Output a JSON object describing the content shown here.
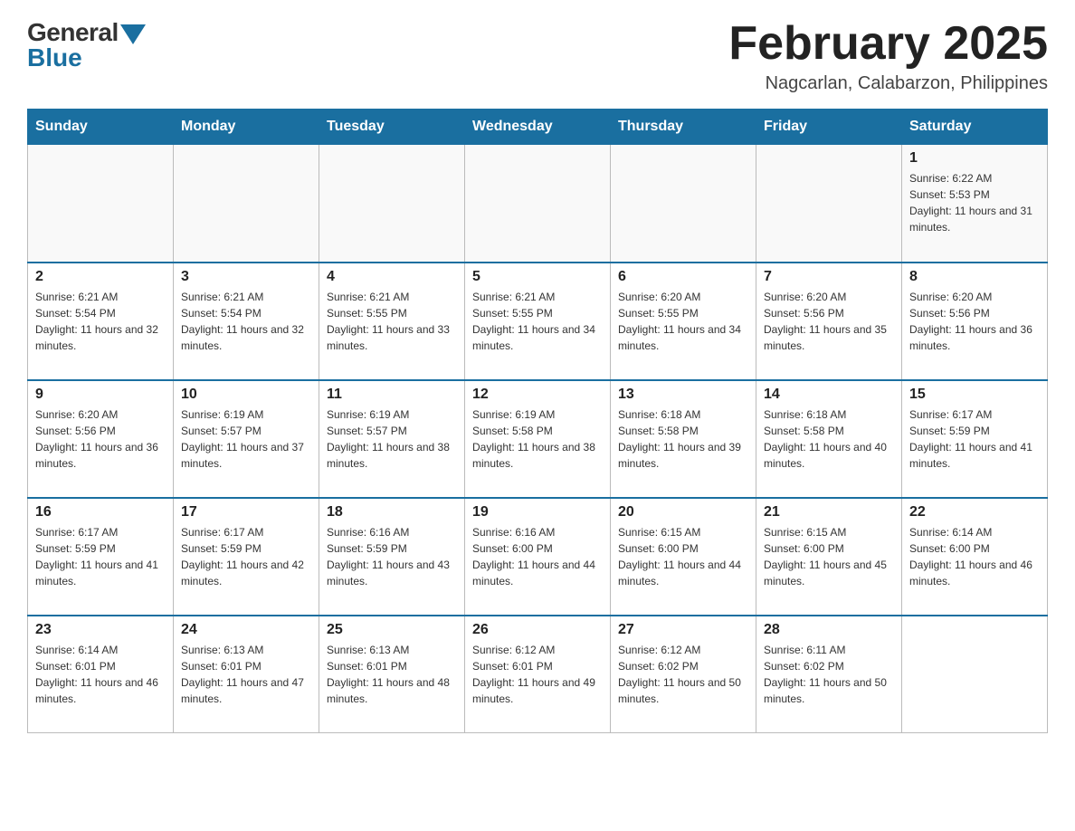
{
  "header": {
    "logo_general": "General",
    "logo_blue": "Blue",
    "month_title": "February 2025",
    "location": "Nagcarlan, Calabarzon, Philippines"
  },
  "weekdays": [
    "Sunday",
    "Monday",
    "Tuesday",
    "Wednesday",
    "Thursday",
    "Friday",
    "Saturday"
  ],
  "weeks": [
    [
      {
        "day": "",
        "sunrise": "",
        "sunset": "",
        "daylight": ""
      },
      {
        "day": "",
        "sunrise": "",
        "sunset": "",
        "daylight": ""
      },
      {
        "day": "",
        "sunrise": "",
        "sunset": "",
        "daylight": ""
      },
      {
        "day": "",
        "sunrise": "",
        "sunset": "",
        "daylight": ""
      },
      {
        "day": "",
        "sunrise": "",
        "sunset": "",
        "daylight": ""
      },
      {
        "day": "",
        "sunrise": "",
        "sunset": "",
        "daylight": ""
      },
      {
        "day": "1",
        "sunrise": "Sunrise: 6:22 AM",
        "sunset": "Sunset: 5:53 PM",
        "daylight": "Daylight: 11 hours and 31 minutes."
      }
    ],
    [
      {
        "day": "2",
        "sunrise": "Sunrise: 6:21 AM",
        "sunset": "Sunset: 5:54 PM",
        "daylight": "Daylight: 11 hours and 32 minutes."
      },
      {
        "day": "3",
        "sunrise": "Sunrise: 6:21 AM",
        "sunset": "Sunset: 5:54 PM",
        "daylight": "Daylight: 11 hours and 32 minutes."
      },
      {
        "day": "4",
        "sunrise": "Sunrise: 6:21 AM",
        "sunset": "Sunset: 5:55 PM",
        "daylight": "Daylight: 11 hours and 33 minutes."
      },
      {
        "day": "5",
        "sunrise": "Sunrise: 6:21 AM",
        "sunset": "Sunset: 5:55 PM",
        "daylight": "Daylight: 11 hours and 34 minutes."
      },
      {
        "day": "6",
        "sunrise": "Sunrise: 6:20 AM",
        "sunset": "Sunset: 5:55 PM",
        "daylight": "Daylight: 11 hours and 34 minutes."
      },
      {
        "day": "7",
        "sunrise": "Sunrise: 6:20 AM",
        "sunset": "Sunset: 5:56 PM",
        "daylight": "Daylight: 11 hours and 35 minutes."
      },
      {
        "day": "8",
        "sunrise": "Sunrise: 6:20 AM",
        "sunset": "Sunset: 5:56 PM",
        "daylight": "Daylight: 11 hours and 36 minutes."
      }
    ],
    [
      {
        "day": "9",
        "sunrise": "Sunrise: 6:20 AM",
        "sunset": "Sunset: 5:56 PM",
        "daylight": "Daylight: 11 hours and 36 minutes."
      },
      {
        "day": "10",
        "sunrise": "Sunrise: 6:19 AM",
        "sunset": "Sunset: 5:57 PM",
        "daylight": "Daylight: 11 hours and 37 minutes."
      },
      {
        "day": "11",
        "sunrise": "Sunrise: 6:19 AM",
        "sunset": "Sunset: 5:57 PM",
        "daylight": "Daylight: 11 hours and 38 minutes."
      },
      {
        "day": "12",
        "sunrise": "Sunrise: 6:19 AM",
        "sunset": "Sunset: 5:58 PM",
        "daylight": "Daylight: 11 hours and 38 minutes."
      },
      {
        "day": "13",
        "sunrise": "Sunrise: 6:18 AM",
        "sunset": "Sunset: 5:58 PM",
        "daylight": "Daylight: 11 hours and 39 minutes."
      },
      {
        "day": "14",
        "sunrise": "Sunrise: 6:18 AM",
        "sunset": "Sunset: 5:58 PM",
        "daylight": "Daylight: 11 hours and 40 minutes."
      },
      {
        "day": "15",
        "sunrise": "Sunrise: 6:17 AM",
        "sunset": "Sunset: 5:59 PM",
        "daylight": "Daylight: 11 hours and 41 minutes."
      }
    ],
    [
      {
        "day": "16",
        "sunrise": "Sunrise: 6:17 AM",
        "sunset": "Sunset: 5:59 PM",
        "daylight": "Daylight: 11 hours and 41 minutes."
      },
      {
        "day": "17",
        "sunrise": "Sunrise: 6:17 AM",
        "sunset": "Sunset: 5:59 PM",
        "daylight": "Daylight: 11 hours and 42 minutes."
      },
      {
        "day": "18",
        "sunrise": "Sunrise: 6:16 AM",
        "sunset": "Sunset: 5:59 PM",
        "daylight": "Daylight: 11 hours and 43 minutes."
      },
      {
        "day": "19",
        "sunrise": "Sunrise: 6:16 AM",
        "sunset": "Sunset: 6:00 PM",
        "daylight": "Daylight: 11 hours and 44 minutes."
      },
      {
        "day": "20",
        "sunrise": "Sunrise: 6:15 AM",
        "sunset": "Sunset: 6:00 PM",
        "daylight": "Daylight: 11 hours and 44 minutes."
      },
      {
        "day": "21",
        "sunrise": "Sunrise: 6:15 AM",
        "sunset": "Sunset: 6:00 PM",
        "daylight": "Daylight: 11 hours and 45 minutes."
      },
      {
        "day": "22",
        "sunrise": "Sunrise: 6:14 AM",
        "sunset": "Sunset: 6:00 PM",
        "daylight": "Daylight: 11 hours and 46 minutes."
      }
    ],
    [
      {
        "day": "23",
        "sunrise": "Sunrise: 6:14 AM",
        "sunset": "Sunset: 6:01 PM",
        "daylight": "Daylight: 11 hours and 46 minutes."
      },
      {
        "day": "24",
        "sunrise": "Sunrise: 6:13 AM",
        "sunset": "Sunset: 6:01 PM",
        "daylight": "Daylight: 11 hours and 47 minutes."
      },
      {
        "day": "25",
        "sunrise": "Sunrise: 6:13 AM",
        "sunset": "Sunset: 6:01 PM",
        "daylight": "Daylight: 11 hours and 48 minutes."
      },
      {
        "day": "26",
        "sunrise": "Sunrise: 6:12 AM",
        "sunset": "Sunset: 6:01 PM",
        "daylight": "Daylight: 11 hours and 49 minutes."
      },
      {
        "day": "27",
        "sunrise": "Sunrise: 6:12 AM",
        "sunset": "Sunset: 6:02 PM",
        "daylight": "Daylight: 11 hours and 50 minutes."
      },
      {
        "day": "28",
        "sunrise": "Sunrise: 6:11 AM",
        "sunset": "Sunset: 6:02 PM",
        "daylight": "Daylight: 11 hours and 50 minutes."
      },
      {
        "day": "",
        "sunrise": "",
        "sunset": "",
        "daylight": ""
      }
    ]
  ]
}
